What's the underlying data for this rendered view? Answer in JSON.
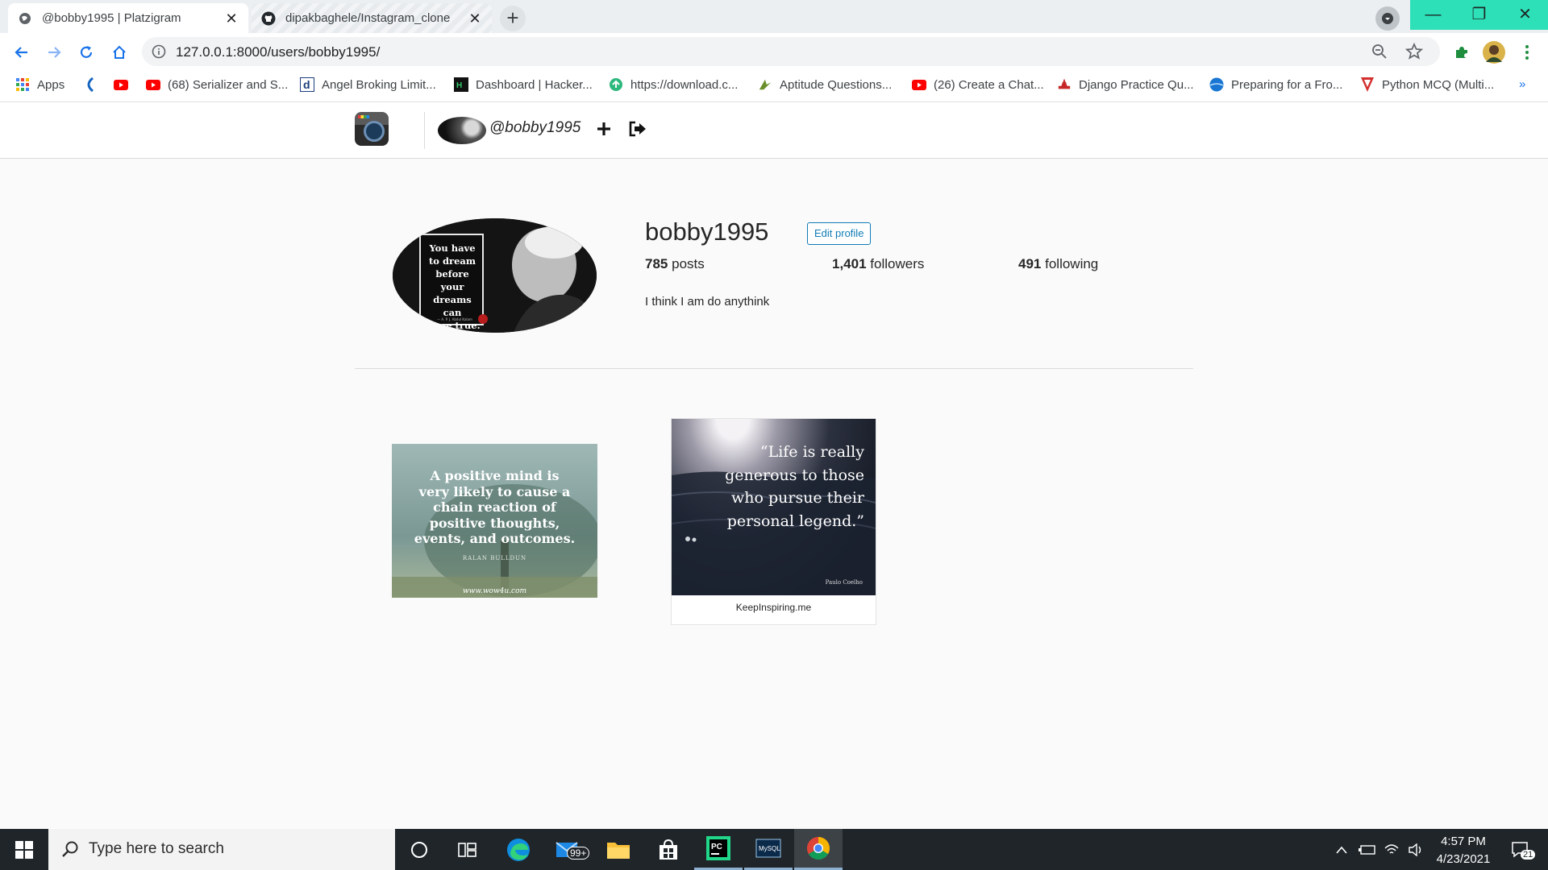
{
  "browser": {
    "tabs": [
      {
        "title": "@bobby1995 | Platzigram",
        "active": true
      },
      {
        "title": "dipakbaghele/Instagram_clone",
        "active": false
      }
    ],
    "new_tab": "+",
    "tab_close": "✕",
    "window": {
      "minimize": "—",
      "restore": "❐",
      "close": "✕"
    },
    "url": "127.0.0.1:8000/users/bobby1995/",
    "bookmarks": [
      {
        "label": "Apps",
        "icon": "apps-grid-icon"
      },
      {
        "label": "",
        "icon": "kotak-icon"
      },
      {
        "label": "",
        "icon": "youtube-icon"
      },
      {
        "label": "(68) Serializer and S...",
        "icon": "youtube-icon"
      },
      {
        "label": "Angel Broking Limit...",
        "icon": "angel-d-icon"
      },
      {
        "label": "Dashboard | Hacker...",
        "icon": "hackerrank-icon"
      },
      {
        "label": "https://download.c...",
        "icon": "globe-icon"
      },
      {
        "label": "Aptitude Questions...",
        "icon": "indiabix-icon"
      },
      {
        "label": "(26) Create a Chat...",
        "icon": "youtube-icon"
      },
      {
        "label": "Django Practice Qu...",
        "icon": "django-icon"
      },
      {
        "label": "Preparing for a Fro...",
        "icon": "blue-globe-icon"
      },
      {
        "label": "Python MCQ (Multi...",
        "icon": "sanfoundry-icon"
      }
    ],
    "bookmarks_overflow": "»"
  },
  "navbar": {
    "username": "@bobby1995"
  },
  "profile": {
    "username": "bobby1995",
    "edit_button": "Edit profile",
    "posts_count": "785",
    "posts_label": "posts",
    "followers_count": "1,401",
    "followers_label": "followers",
    "following_count": "491",
    "following_label": "following",
    "bio": "I think I am do anythink",
    "avatar_quote_lines": [
      "You have",
      "to dream",
      "before your",
      "dreams can",
      "come true."
    ],
    "avatar_quote_author": "— A. P. J. Abdul Kalam"
  },
  "posts": [
    {
      "quote_lines": [
        "A positive mind is",
        "very likely to cause a",
        "chain reaction of",
        "positive thoughts,",
        "events, and outcomes."
      ],
      "author": "RALAN BULLDUN",
      "site": "www.wow4u.com"
    },
    {
      "quote_lines": [
        "“Life is really",
        "generous to those",
        "who pursue their",
        "personal legend.”"
      ],
      "author": "Paulo Coelho",
      "caption": "KeepInspiring.me"
    }
  ],
  "taskbar": {
    "search_placeholder": "Type here to search",
    "mail_badge": "99+",
    "time": "4:57 PM",
    "date": "4/23/2021",
    "notifications": "21"
  }
}
